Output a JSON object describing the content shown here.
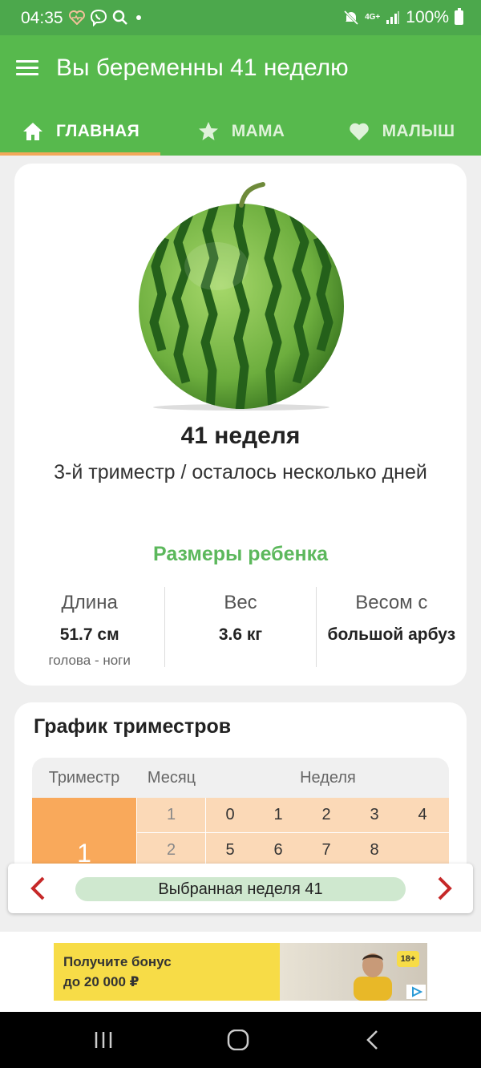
{
  "status": {
    "time": "04:35",
    "battery": "100%",
    "network": "4G+"
  },
  "appbar": {
    "title": "Вы беременны 41 неделю"
  },
  "tabs": [
    {
      "label": "ГЛАВНАЯ",
      "icon": "home-icon",
      "active": true
    },
    {
      "label": "МАМА",
      "icon": "star-icon",
      "active": false
    },
    {
      "label": "МАЛЫШ",
      "icon": "heart-icon",
      "active": false
    }
  ],
  "week_card": {
    "title": "41 неделя",
    "note": "3-й триместр / осталось несколько дней",
    "sizes_title": "Размеры ребенка",
    "stats": [
      {
        "label": "Длина",
        "value": "51.7 см",
        "sub": "голова - ноги"
      },
      {
        "label": "Вес",
        "value": "3.6 кг",
        "sub": ""
      },
      {
        "label": "Весом с",
        "value": "большой арбуз",
        "sub": ""
      }
    ]
  },
  "trimester_card": {
    "title": "График триместров",
    "headers": [
      "Триместр",
      "Месяц",
      "Неделя"
    ],
    "trimester": "1",
    "rows": [
      {
        "month": "1",
        "weeks": [
          "0",
          "1",
          "2",
          "3",
          "4"
        ]
      },
      {
        "month": "2",
        "weeks": [
          "5",
          "6",
          "7",
          "8",
          ""
        ]
      }
    ]
  },
  "selector": {
    "label": "Выбранная неделя 41"
  },
  "ad": {
    "line1": "Получите бонус",
    "line2": "до 20 000 ₽",
    "age": "18+"
  },
  "colors": {
    "primary": "#57b94d",
    "accent": "#f2a85a",
    "trimester1": "#f9a95b",
    "month_bg": "#fbd9b7",
    "arrow": "#c62828"
  }
}
